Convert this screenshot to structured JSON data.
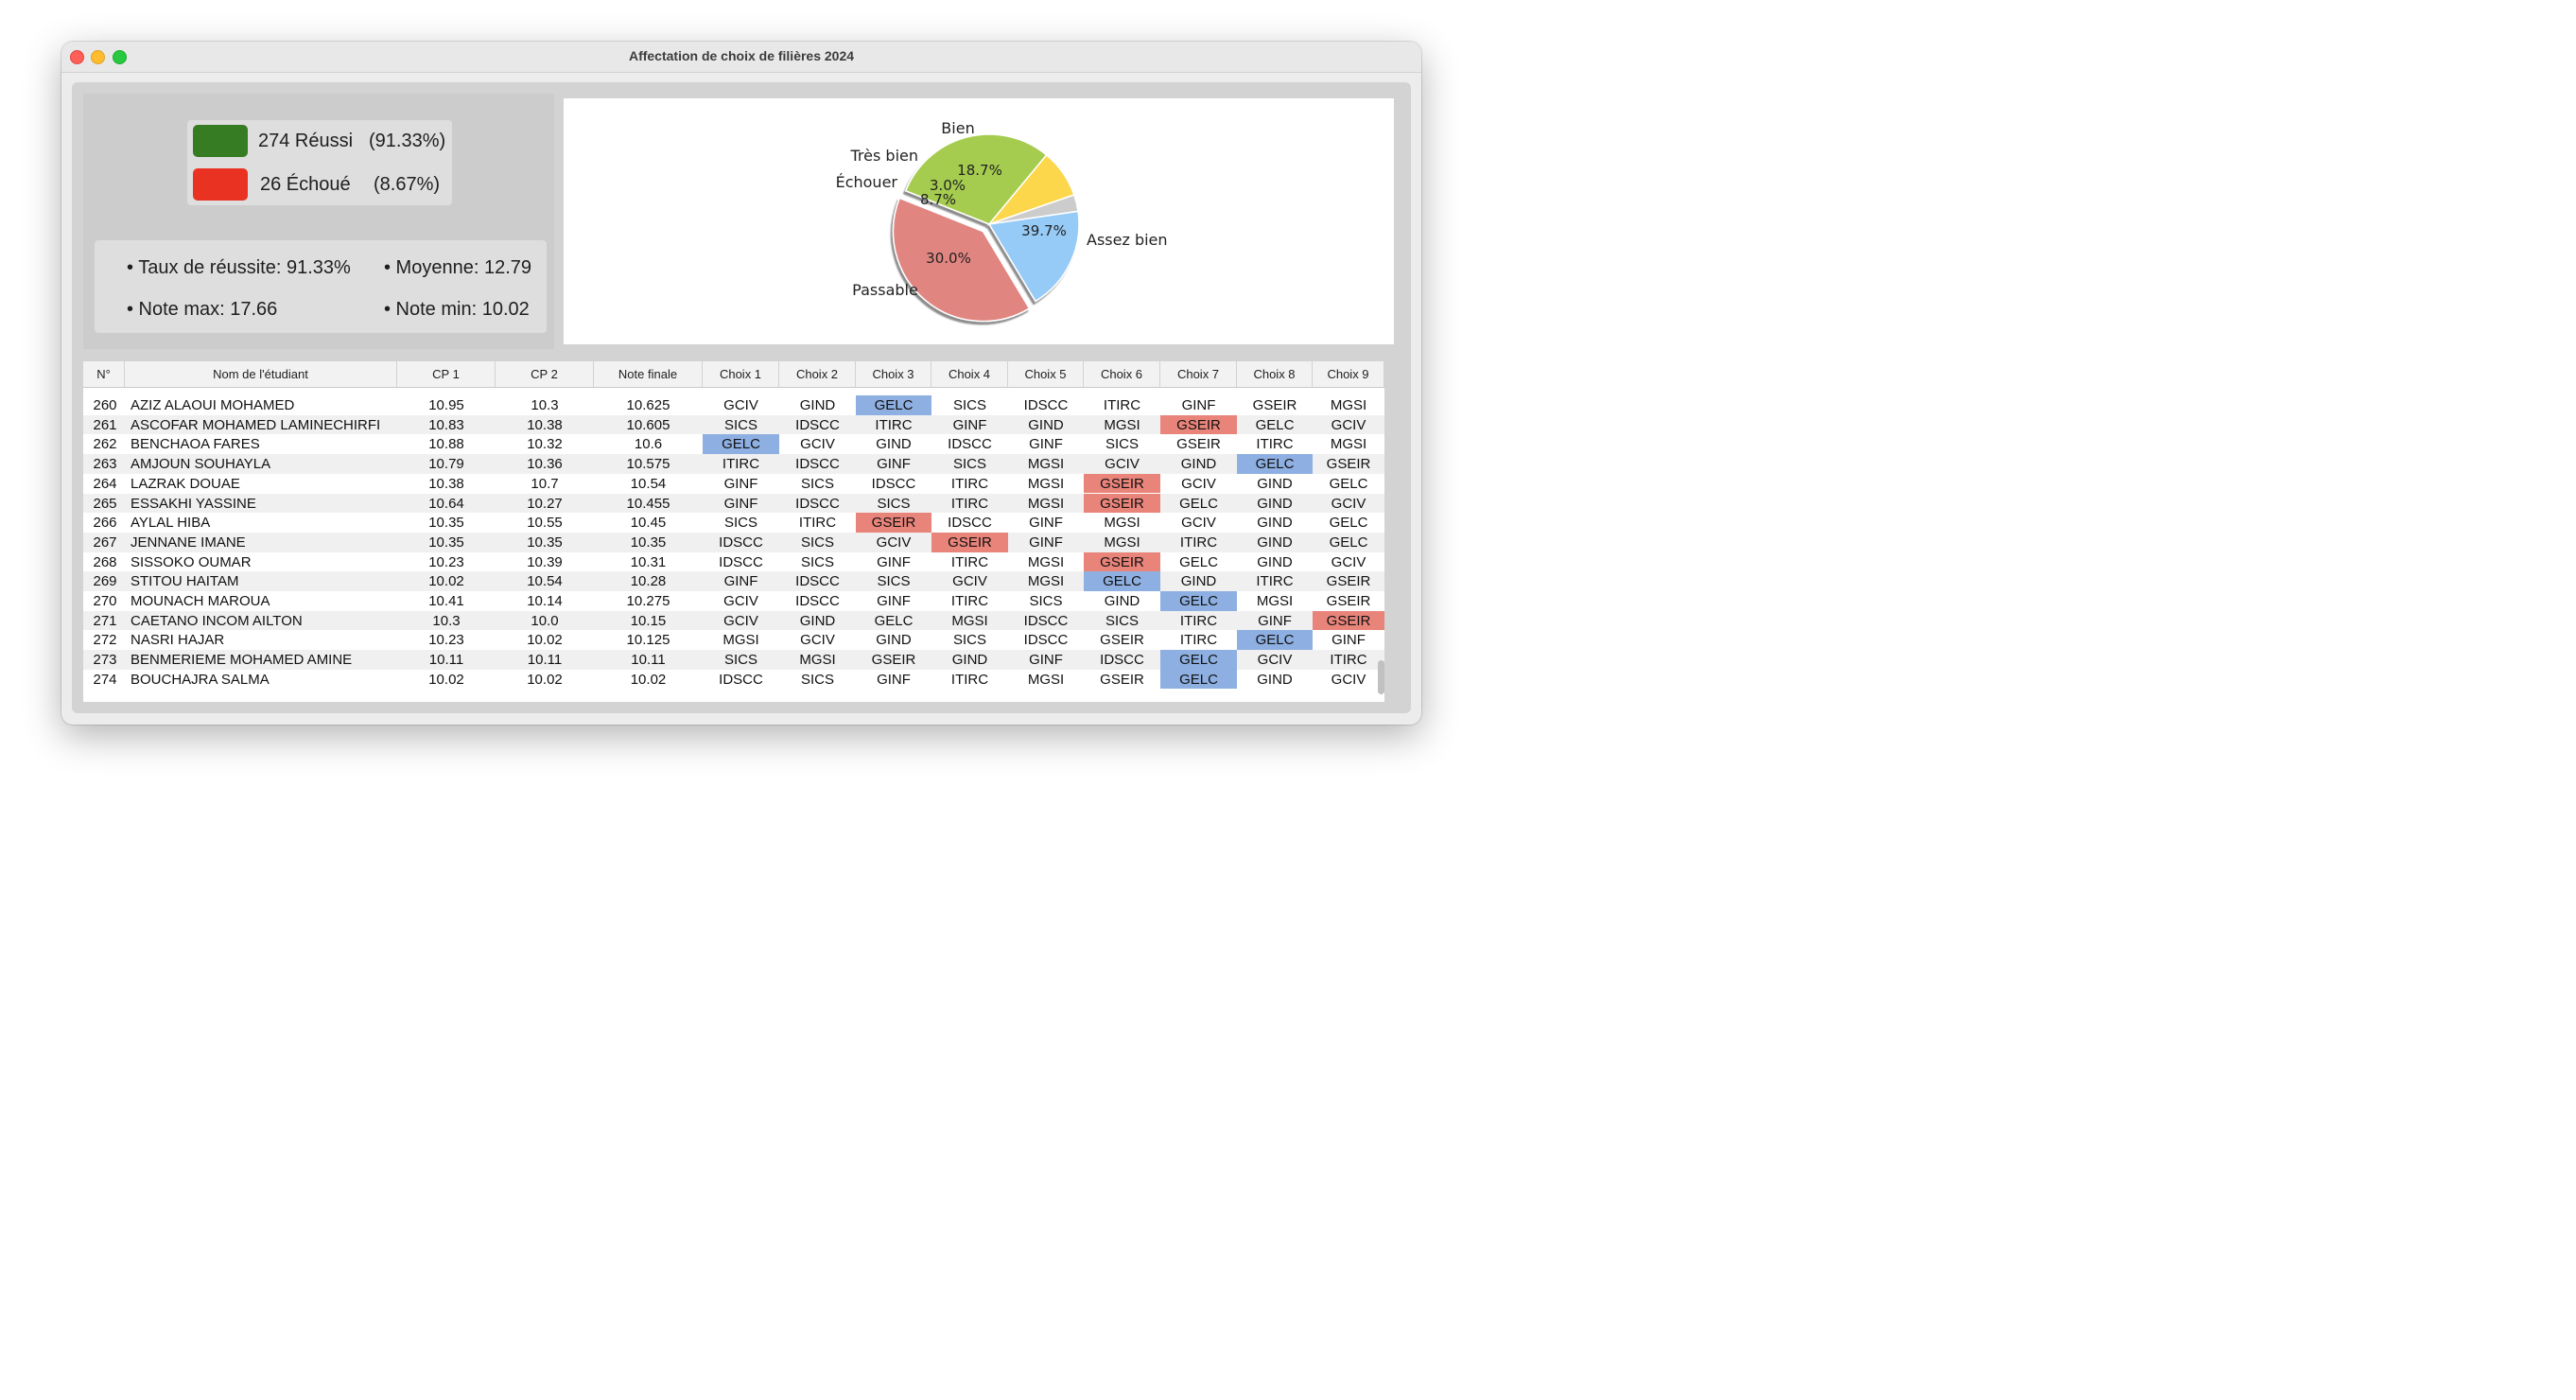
{
  "window": {
    "title": "Affectation de choix de filières 2024"
  },
  "legend": [
    {
      "label": "274 Réussi",
      "pct": "(91.33%)",
      "color": "#367c22"
    },
    {
      "label": "26 Échoué",
      "pct": "(8.67%)",
      "color": "#ea3223"
    }
  ],
  "stats": {
    "taux": "• Taux de réussite: 91.33%",
    "moyenne": "• Moyenne: 12.79",
    "max": "• Note max: 17.66",
    "min": "• Note min: 10.02"
  },
  "chart_data": {
    "type": "pie",
    "slices": [
      {
        "label": "Assez bien",
        "pct": "39.7%",
        "value": 39.7,
        "color": "#e18581"
      },
      {
        "label": "Passable",
        "pct": "30.0%",
        "value": 30.0,
        "color": "#a5cc4f"
      },
      {
        "label": "Échouer",
        "pct": "8.7%",
        "value": 8.7,
        "color": "#fcd74b"
      },
      {
        "label": "Très bien",
        "pct": "3.0%",
        "value": 3.0,
        "color": "#cccccc"
      },
      {
        "label": "Bien",
        "pct": "18.7%",
        "value": 18.7,
        "color": "#96cbf7"
      }
    ]
  },
  "table": {
    "headers": [
      "N°",
      "Nom de l'étudiant",
      "CP 1",
      "CP 2",
      "Note finale",
      "Choix 1",
      "Choix 2",
      "Choix 3",
      "Choix 4",
      "Choix 5",
      "Choix 6",
      "Choix 7",
      "Choix 8",
      "Choix 9"
    ],
    "rows": [
      [
        "260",
        "AZIZ ALAOUI MOHAMED",
        "10.95",
        "10.3",
        "10.625",
        "GCIV",
        "GIND",
        "GELC",
        "SICS",
        "IDSCC",
        "ITIRC",
        "GINF",
        "GSEIR",
        "MGSI"
      ],
      [
        "261",
        "ASCOFAR MOHAMED LAMINECHIRFI",
        "10.83",
        "10.38",
        "10.605",
        "SICS",
        "IDSCC",
        "ITIRC",
        "GINF",
        "GIND",
        "MGSI",
        "GSEIR",
        "GELC",
        "GCIV"
      ],
      [
        "262",
        "BENCHAOA FARES",
        "10.88",
        "10.32",
        "10.6",
        "GELC",
        "GCIV",
        "GIND",
        "IDSCC",
        "GINF",
        "SICS",
        "GSEIR",
        "ITIRC",
        "MGSI"
      ],
      [
        "263",
        "AMJOUN SOUHAYLA",
        "10.79",
        "10.36",
        "10.575",
        "ITIRC",
        "IDSCC",
        "GINF",
        "SICS",
        "MGSI",
        "GCIV",
        "GIND",
        "GELC",
        "GSEIR"
      ],
      [
        "264",
        "LAZRAK DOUAE",
        "10.38",
        "10.7",
        "10.54",
        "GINF",
        "SICS",
        "IDSCC",
        "ITIRC",
        "MGSI",
        "GSEIR",
        "GCIV",
        "GIND",
        "GELC"
      ],
      [
        "265",
        "ESSAKHI YASSINE",
        "10.64",
        "10.27",
        "10.455",
        "GINF",
        "IDSCC",
        "SICS",
        "ITIRC",
        "MGSI",
        "GSEIR",
        "GELC",
        "GIND",
        "GCIV"
      ],
      [
        "266",
        "AYLAL HIBA",
        "10.35",
        "10.55",
        "10.45",
        "SICS",
        "ITIRC",
        "GSEIR",
        "IDSCC",
        "GINF",
        "MGSI",
        "GCIV",
        "GIND",
        "GELC"
      ],
      [
        "267",
        "JENNANE IMANE",
        "10.35",
        "10.35",
        "10.35",
        "IDSCC",
        "SICS",
        "GCIV",
        "GSEIR",
        "GINF",
        "MGSI",
        "ITIRC",
        "GIND",
        "GELC"
      ],
      [
        "268",
        "SISSOKO OUMAR",
        "10.23",
        "10.39",
        "10.31",
        "IDSCC",
        "SICS",
        "GINF",
        "ITIRC",
        "MGSI",
        "GSEIR",
        "GELC",
        "GIND",
        "GCIV"
      ],
      [
        "269",
        "STITOU HAITAM",
        "10.02",
        "10.54",
        "10.28",
        "GINF",
        "IDSCC",
        "SICS",
        "GCIV",
        "MGSI",
        "GELC",
        "GIND",
        "ITIRC",
        "GSEIR"
      ],
      [
        "270",
        "MOUNACH MAROUA",
        "10.41",
        "10.14",
        "10.275",
        "GCIV",
        "IDSCC",
        "GINF",
        "ITIRC",
        "SICS",
        "GIND",
        "GELC",
        "MGSI",
        "GSEIR"
      ],
      [
        "271",
        "CAETANO INCOM AILTON",
        "10.3",
        "10.0",
        "10.15",
        "GCIV",
        "GIND",
        "GELC",
        "MGSI",
        "IDSCC",
        "SICS",
        "ITIRC",
        "GINF",
        "GSEIR"
      ],
      [
        "272",
        "NASRI HAJAR",
        "10.23",
        "10.02",
        "10.125",
        "MGSI",
        "GCIV",
        "GIND",
        "SICS",
        "IDSCC",
        "GSEIR",
        "ITIRC",
        "GELC",
        "GINF"
      ],
      [
        "273",
        "BENMERIEME MOHAMED AMINE",
        "10.11",
        "10.11",
        "10.11",
        "SICS",
        "MGSI",
        "GSEIR",
        "GIND",
        "GINF",
        "IDSCC",
        "GELC",
        "GCIV",
        "ITIRC"
      ],
      [
        "274",
        "BOUCHAJRA SALMA",
        "10.02",
        "10.02",
        "10.02",
        "IDSCC",
        "SICS",
        "GINF",
        "ITIRC",
        "MGSI",
        "GSEIR",
        "GELC",
        "GIND",
        "GCIV"
      ]
    ],
    "highlights": [
      {
        "row": 0,
        "col": 7,
        "color": "blue"
      },
      {
        "row": 1,
        "col": 11,
        "color": "red"
      },
      {
        "row": 2,
        "col": 5,
        "color": "blue"
      },
      {
        "row": 3,
        "col": 12,
        "color": "blue"
      },
      {
        "row": 4,
        "col": 10,
        "color": "red"
      },
      {
        "row": 5,
        "col": 10,
        "color": "red"
      },
      {
        "row": 6,
        "col": 7,
        "color": "red"
      },
      {
        "row": 7,
        "col": 8,
        "color": "red"
      },
      {
        "row": 8,
        "col": 10,
        "color": "red"
      },
      {
        "row": 9,
        "col": 10,
        "color": "blue"
      },
      {
        "row": 10,
        "col": 11,
        "color": "blue"
      },
      {
        "row": 11,
        "col": 13,
        "color": "red"
      },
      {
        "row": 12,
        "col": 12,
        "color": "blue"
      },
      {
        "row": 13,
        "col": 11,
        "color": "blue"
      },
      {
        "row": 14,
        "col": 11,
        "color": "blue"
      }
    ]
  }
}
